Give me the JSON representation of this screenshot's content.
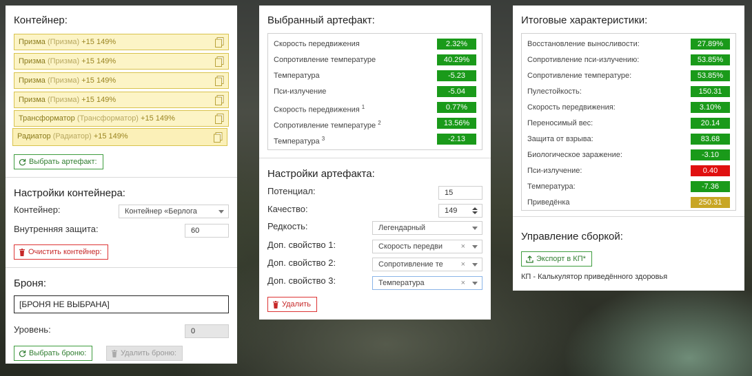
{
  "container": {
    "title": "Контейнер:",
    "slots": [
      {
        "name": "Призма",
        "sub": "(Призма)",
        "bonus": "+15 149%"
      },
      {
        "name": "Призма",
        "sub": "(Призма)",
        "bonus": "+15 149%"
      },
      {
        "name": "Призма",
        "sub": "(Призма)",
        "bonus": "+15 149%"
      },
      {
        "name": "Призма",
        "sub": "(Призма)",
        "bonus": "+15 149%"
      },
      {
        "name": "Трансформатор",
        "sub": "(Трансформатор)",
        "bonus": "+15 149%"
      },
      {
        "name": "Радиатор",
        "sub": "(Радиатор)",
        "bonus": "+15 149%"
      }
    ],
    "select_artifact_label": "Выбрать артефакт:"
  },
  "container_settings": {
    "title": "Настройки контейнера:",
    "container_label": "Контейнер:",
    "container_value": "Контейнер «Берлога",
    "inner_protection_label": "Внутренняя защита:",
    "inner_protection_value": "60",
    "clear_label": "Очистить контейнер:"
  },
  "armor": {
    "title": "Броня:",
    "armor_value": "[БРОНЯ НЕ ВЫБРАНА]",
    "level_label": "Уровень:",
    "level_value": "0",
    "select_label": "Выбрать броню:",
    "delete_label": "Удалить броню:"
  },
  "selected_artifact": {
    "title": "Выбранный артефакт:",
    "stats": [
      {
        "label": "Скорость передвижения",
        "sup": "",
        "value": "2.32%",
        "color": "green"
      },
      {
        "label": "Сопротивление температуре",
        "sup": "",
        "value": "40.29%",
        "color": "green"
      },
      {
        "label": "Температура",
        "sup": "",
        "value": "-5.23",
        "color": "green"
      },
      {
        "label": "Пси-излучение",
        "sup": "",
        "value": "-5.04",
        "color": "green"
      },
      {
        "label": "Скорость передвижения",
        "sup": "1",
        "value": "0.77%",
        "color": "green"
      },
      {
        "label": "Сопротивление температуре",
        "sup": "2",
        "value": "13.56%",
        "color": "green"
      },
      {
        "label": "Температура",
        "sup": "3",
        "value": "-2.13",
        "color": "green"
      }
    ]
  },
  "artifact_settings": {
    "title": "Настройки артефакта:",
    "potential_label": "Потенциал:",
    "potential_value": "15",
    "quality_label": "Качество:",
    "quality_value": "149",
    "rarity_label": "Редкость:",
    "rarity_value": "Легендарный",
    "extra1_label": "Доп. свойство 1:",
    "extra1_value": "Скорость передви",
    "extra2_label": "Доп. свойство 2:",
    "extra2_value": "Сопротивление те",
    "extra3_label": "Доп. свойство 3:",
    "extra3_value": "Температура",
    "delete_label": "Удалить"
  },
  "totals": {
    "title": "Итоговые характеристики:",
    "stats": [
      {
        "label": "Восстановление выносливости:",
        "value": "27.89%",
        "color": "green"
      },
      {
        "label": "Сопротивление пси-излучению:",
        "value": "53.85%",
        "color": "green"
      },
      {
        "label": "Сопротивление температуре:",
        "value": "53.85%",
        "color": "green"
      },
      {
        "label": "Пулестойкость:",
        "value": "150.31",
        "color": "green"
      },
      {
        "label": "Скорость передвижения:",
        "value": "3.10%",
        "color": "green"
      },
      {
        "label": "Переносимый вес:",
        "value": "20.14",
        "color": "green"
      },
      {
        "label": "Защита от взрыва:",
        "value": "83.68",
        "color": "green"
      },
      {
        "label": "Биологическое заражение:",
        "value": "-3.10",
        "color": "green"
      },
      {
        "label": "Пси-излучение:",
        "value": "0.40",
        "color": "red"
      },
      {
        "label": "Температура:",
        "value": "-7.36",
        "color": "green"
      },
      {
        "label": "Приведёнка",
        "value": "250.31",
        "color": "yellow"
      }
    ]
  },
  "build": {
    "title": "Управление сборкой:",
    "export_label": "Экспорт в КП*",
    "note": "КП - Калькулятор приведённого здоровья"
  },
  "colors": {
    "green": "#1a9a1a",
    "red": "#e01010",
    "yellow": "#c8a624",
    "slot_bg": "#fcf4c6",
    "slot_border": "#d8c24c"
  },
  "icons": [
    "copy-icon",
    "refresh-icon",
    "trash-icon",
    "upload-icon",
    "chevron-down-icon",
    "clear-x-icon",
    "spinner-arrows-icon"
  ]
}
